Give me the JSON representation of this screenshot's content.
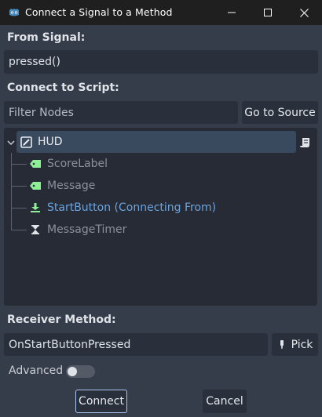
{
  "window": {
    "title": "Connect a Signal to a Method",
    "minimize_icon": "minimize-icon",
    "maximize_icon": "maximize-icon",
    "close_icon": "close-icon"
  },
  "from_signal": {
    "label": "From Signal:",
    "value": "pressed()"
  },
  "connect_to_script": {
    "label": "Connect to Script:",
    "filter_placeholder": "Filter Nodes",
    "go_to_source_label": "Go to Source"
  },
  "tree": {
    "root": {
      "label": "HUD",
      "icon": "control-node-icon",
      "script_icon": "script-icon"
    },
    "children": [
      {
        "label": "ScoreLabel",
        "icon": "label-node-icon",
        "color": "#8b919c"
      },
      {
        "label": "Message",
        "icon": "label-node-icon",
        "color": "#8b919c"
      },
      {
        "label": "StartButton (Connecting From)",
        "icon": "button-node-icon",
        "color": "#6ba3dd"
      },
      {
        "label": "MessageTimer",
        "icon": "timer-node-icon",
        "color": "#8b919c"
      }
    ]
  },
  "receiver": {
    "label": "Receiver Method:",
    "value": "OnStartButtonPressed",
    "pick_label": "Pick",
    "pick_icon": "eyedropper-icon"
  },
  "advanced": {
    "label": "Advanced",
    "enabled": false
  },
  "footer": {
    "connect_label": "Connect",
    "cancel_label": "Cancel"
  },
  "colors": {
    "accent_green": "#8eef97",
    "accent_blue": "#6ba3dd",
    "selection": "#3a4a5e",
    "panel": "#363d4a"
  }
}
